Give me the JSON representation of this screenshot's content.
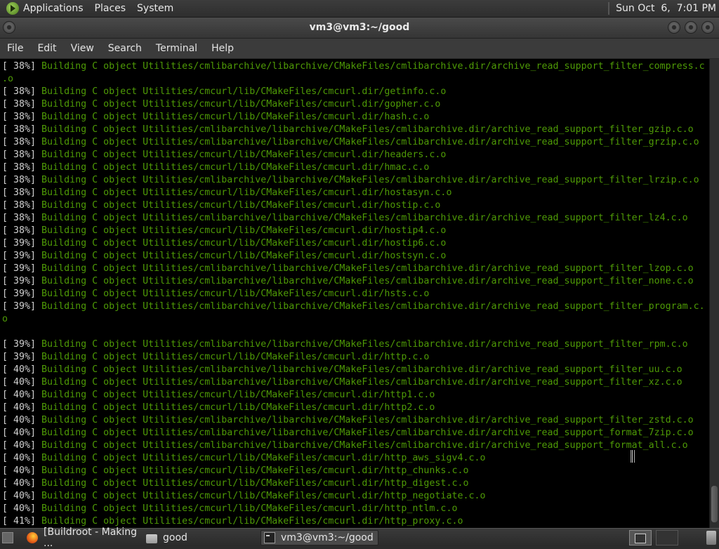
{
  "top_panel": {
    "menus": [
      "Applications",
      "Places",
      "System"
    ],
    "clock": "Sun Oct  6,  7:01 PM"
  },
  "window": {
    "title": "vm3@vm3:~/good"
  },
  "menubar": [
    "File",
    "Edit",
    "View",
    "Search",
    "Terminal",
    "Help"
  ],
  "terminal": {
    "lines": [
      {
        "pct": "[ 38%]",
        "msg": " Building C object Utilities/cmlibarchive/libarchive/CMakeFiles/cmlibarchive.dir/archive_read_support_filter_compress.c"
      },
      {
        "cont": ".o"
      },
      {
        "pct": "[ 38%]",
        "msg": " Building C object Utilities/cmcurl/lib/CMakeFiles/cmcurl.dir/getinfo.c.o"
      },
      {
        "pct": "[ 38%]",
        "msg": " Building C object Utilities/cmcurl/lib/CMakeFiles/cmcurl.dir/gopher.c.o"
      },
      {
        "pct": "[ 38%]",
        "msg": " Building C object Utilities/cmcurl/lib/CMakeFiles/cmcurl.dir/hash.c.o"
      },
      {
        "pct": "[ 38%]",
        "msg": " Building C object Utilities/cmlibarchive/libarchive/CMakeFiles/cmlibarchive.dir/archive_read_support_filter_gzip.c.o"
      },
      {
        "pct": "[ 38%]",
        "msg": " Building C object Utilities/cmlibarchive/libarchive/CMakeFiles/cmlibarchive.dir/archive_read_support_filter_grzip.c.o"
      },
      {
        "pct": "[ 38%]",
        "msg": " Building C object Utilities/cmcurl/lib/CMakeFiles/cmcurl.dir/headers.c.o"
      },
      {
        "pct": "[ 38%]",
        "msg": " Building C object Utilities/cmcurl/lib/CMakeFiles/cmcurl.dir/hmac.c.o"
      },
      {
        "pct": "[ 38%]",
        "msg": " Building C object Utilities/cmlibarchive/libarchive/CMakeFiles/cmlibarchive.dir/archive_read_support_filter_lrzip.c.o"
      },
      {
        "pct": "[ 38%]",
        "msg": " Building C object Utilities/cmcurl/lib/CMakeFiles/cmcurl.dir/hostasyn.c.o"
      },
      {
        "pct": "[ 38%]",
        "msg": " Building C object Utilities/cmcurl/lib/CMakeFiles/cmcurl.dir/hostip.c.o"
      },
      {
        "pct": "[ 38%]",
        "msg": " Building C object Utilities/cmlibarchive/libarchive/CMakeFiles/cmlibarchive.dir/archive_read_support_filter_lz4.c.o"
      },
      {
        "pct": "[ 38%]",
        "msg": " Building C object Utilities/cmcurl/lib/CMakeFiles/cmcurl.dir/hostip4.c.o"
      },
      {
        "pct": "[ 39%]",
        "msg": " Building C object Utilities/cmcurl/lib/CMakeFiles/cmcurl.dir/hostip6.c.o"
      },
      {
        "pct": "[ 39%]",
        "msg": " Building C object Utilities/cmcurl/lib/CMakeFiles/cmcurl.dir/hostsyn.c.o"
      },
      {
        "pct": "[ 39%]",
        "msg": " Building C object Utilities/cmlibarchive/libarchive/CMakeFiles/cmlibarchive.dir/archive_read_support_filter_lzop.c.o"
      },
      {
        "pct": "[ 39%]",
        "msg": " Building C object Utilities/cmlibarchive/libarchive/CMakeFiles/cmlibarchive.dir/archive_read_support_filter_none.c.o"
      },
      {
        "pct": "[ 39%]",
        "msg": " Building C object Utilities/cmcurl/lib/CMakeFiles/cmcurl.dir/hsts.c.o"
      },
      {
        "pct": "[ 39%]",
        "msg": " Building C object Utilities/cmlibarchive/libarchive/CMakeFiles/cmlibarchive.dir/archive_read_support_filter_program.c."
      },
      {
        "cont": "o"
      },
      {
        "blank": true
      },
      {
        "pct": "[ 39%]",
        "msg": " Building C object Utilities/cmlibarchive/libarchive/CMakeFiles/cmlibarchive.dir/archive_read_support_filter_rpm.c.o"
      },
      {
        "pct": "[ 39%]",
        "msg": " Building C object Utilities/cmcurl/lib/CMakeFiles/cmcurl.dir/http.c.o"
      },
      {
        "pct": "[ 40%]",
        "msg": " Building C object Utilities/cmlibarchive/libarchive/CMakeFiles/cmlibarchive.dir/archive_read_support_filter_uu.c.o"
      },
      {
        "pct": "[ 40%]",
        "msg": " Building C object Utilities/cmlibarchive/libarchive/CMakeFiles/cmlibarchive.dir/archive_read_support_filter_xz.c.o"
      },
      {
        "pct": "[ 40%]",
        "msg": " Building C object Utilities/cmcurl/lib/CMakeFiles/cmcurl.dir/http1.c.o"
      },
      {
        "pct": "[ 40%]",
        "msg": " Building C object Utilities/cmcurl/lib/CMakeFiles/cmcurl.dir/http2.c.o"
      },
      {
        "pct": "[ 40%]",
        "msg": " Building C object Utilities/cmlibarchive/libarchive/CMakeFiles/cmlibarchive.dir/archive_read_support_filter_zstd.c.o"
      },
      {
        "pct": "[ 40%]",
        "msg": " Building C object Utilities/cmlibarchive/libarchive/CMakeFiles/cmlibarchive.dir/archive_read_support_format_7zip.c.o"
      },
      {
        "pct": "[ 40%]",
        "msg": " Building C object Utilities/cmlibarchive/libarchive/CMakeFiles/cmlibarchive.dir/archive_read_support_format_all.c.o"
      },
      {
        "pct": "[ 40%]",
        "msg": " Building C object Utilities/cmcurl/lib/CMakeFiles/cmcurl.dir/http_aws_sigv4.c.o"
      },
      {
        "pct": "[ 40%]",
        "msg": " Building C object Utilities/cmcurl/lib/CMakeFiles/cmcurl.dir/http_chunks.c.o"
      },
      {
        "pct": "[ 40%]",
        "msg": " Building C object Utilities/cmcurl/lib/CMakeFiles/cmcurl.dir/http_digest.c.o"
      },
      {
        "pct": "[ 40%]",
        "msg": " Building C object Utilities/cmcurl/lib/CMakeFiles/cmcurl.dir/http_negotiate.c.o"
      },
      {
        "pct": "[ 40%]",
        "msg": " Building C object Utilities/cmcurl/lib/CMakeFiles/cmcurl.dir/http_ntlm.c.o"
      },
      {
        "pct": "[ 41%]",
        "msg": " Building C object Utilities/cmcurl/lib/CMakeFiles/cmcurl.dir/http_proxy.c.o"
      }
    ]
  },
  "taskbar": {
    "tasks": [
      {
        "label": "[Buildroot - Making ...",
        "icon": "firefox-icon"
      },
      {
        "label": "good",
        "icon": "folder-icon"
      },
      {
        "label": "vm3@vm3:~/good",
        "icon": "terminal-icon"
      }
    ]
  },
  "colors": {
    "terminal_bg": "#000000",
    "output_green": "#4e9a06",
    "percent_text": "#d0d0d0"
  }
}
